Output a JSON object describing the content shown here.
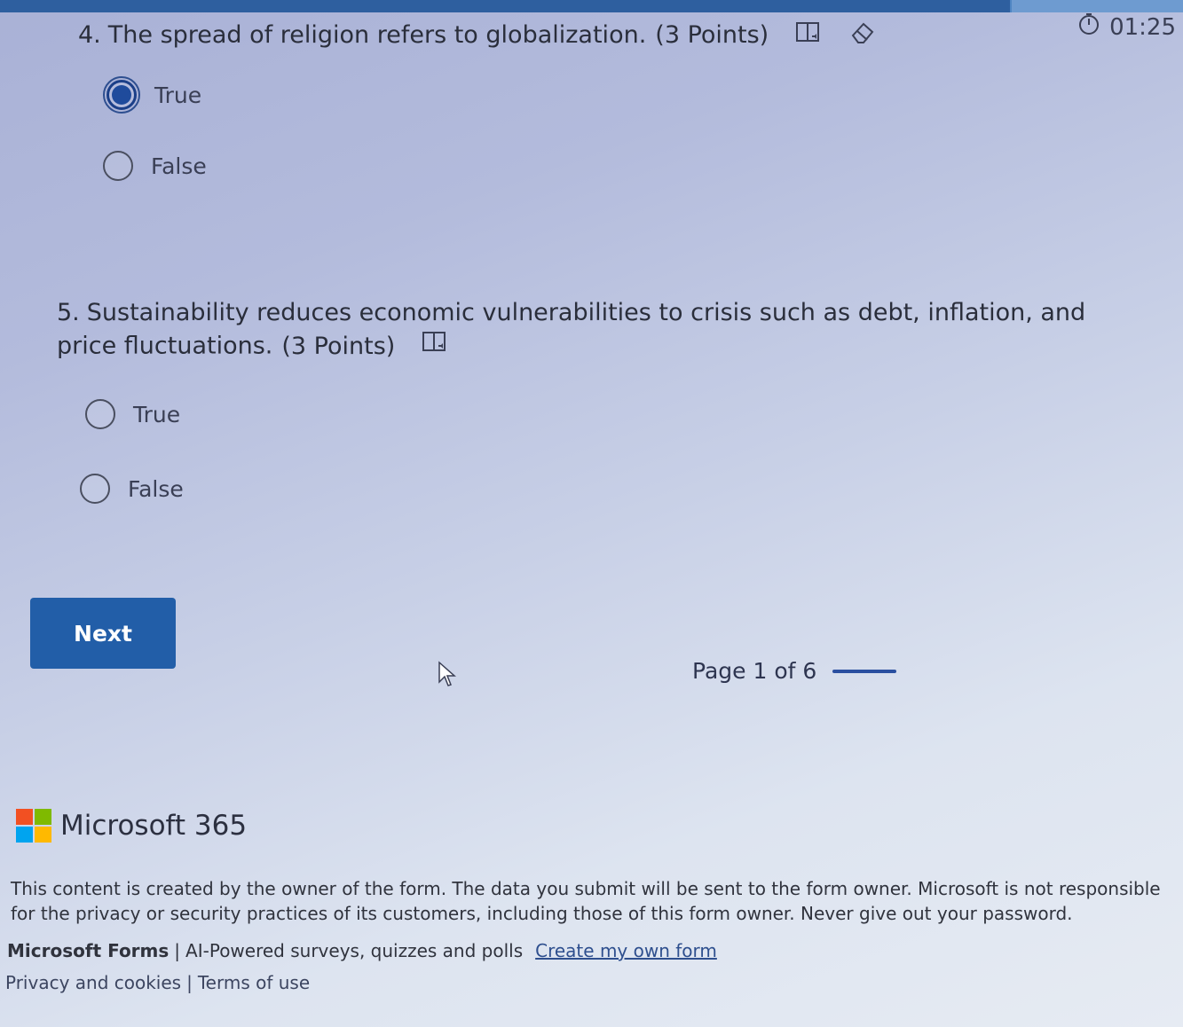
{
  "timer": {
    "value": "01:25"
  },
  "questions": [
    {
      "number": "4.",
      "text": "The spread of religion refers to globalization.",
      "points": "(3 Points)",
      "options": [
        {
          "label": "True",
          "selected": true
        },
        {
          "label": "False",
          "selected": false
        }
      ]
    },
    {
      "number": "5.",
      "text": "Sustainability reduces economic vulnerabilities to crisis such as debt, inflation, and price fluctuations.",
      "points": "(3 Points)",
      "options": [
        {
          "label": "True",
          "selected": false
        },
        {
          "label": "False",
          "selected": false
        }
      ]
    }
  ],
  "navigation": {
    "next_label": "Next",
    "page_indicator": "Page 1 of 6"
  },
  "footer": {
    "brand": "Microsoft 365",
    "disclaimer": "This content is created by the owner of the form. The data you submit will be sent to the form owner. Microsoft is not responsible for the privacy or security practices of its customers, including those of this form owner. Never give out your password.",
    "forms_name": "Microsoft Forms",
    "separator": "|",
    "forms_tagline": "AI-Powered surveys, quizzes and polls",
    "create_link": "Create my own form",
    "privacy_link": "Privacy and cookies",
    "terms_link": "Terms of use"
  },
  "colors": {
    "accent": "#225ea8",
    "selected_radio": "#1f4b9c",
    "progress": "#2e5f9f"
  }
}
